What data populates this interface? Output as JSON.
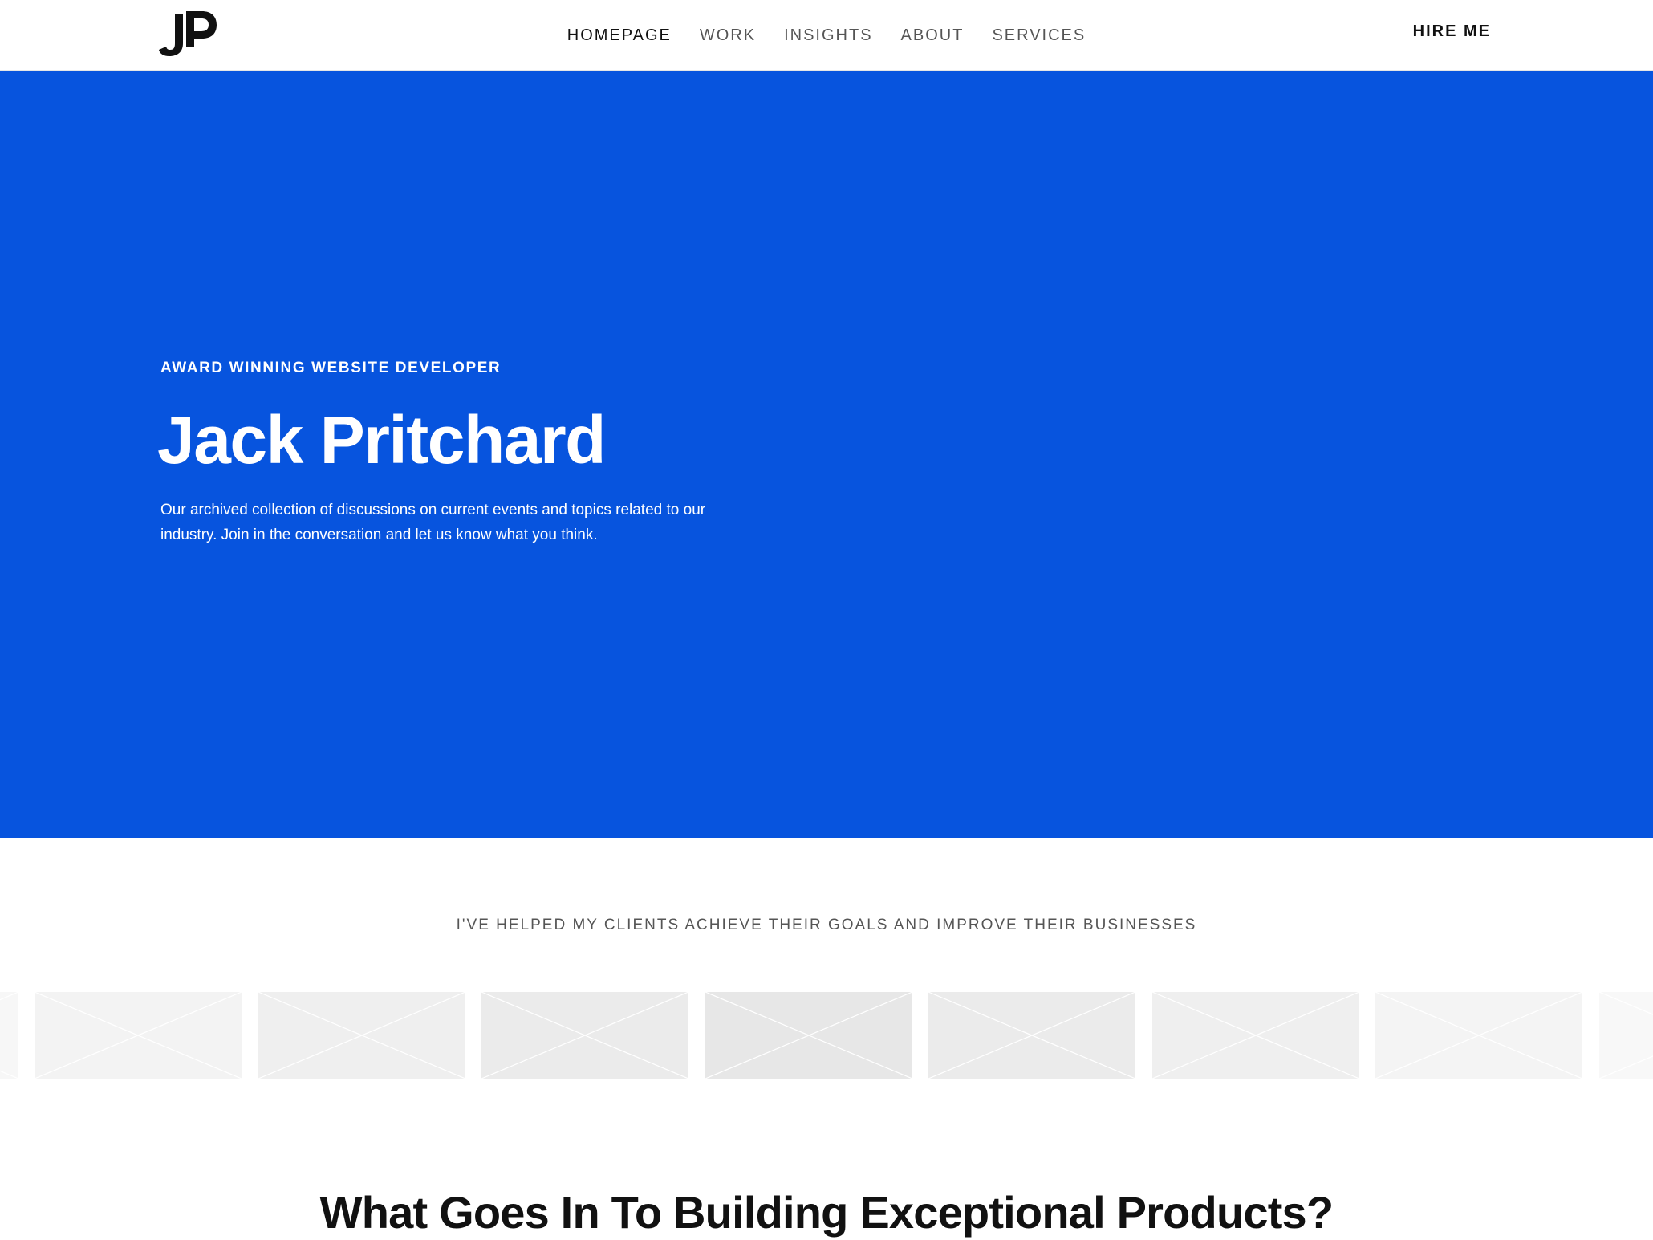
{
  "header": {
    "logo_text": "JP",
    "nav": [
      {
        "label": "HOMEPAGE",
        "active": true
      },
      {
        "label": "WORK",
        "active": false
      },
      {
        "label": "INSIGHTS",
        "active": false
      },
      {
        "label": "ABOUT",
        "active": false
      },
      {
        "label": "SERVICES",
        "active": false
      }
    ],
    "hire_label": "HIRE ME"
  },
  "hero": {
    "eyebrow": "AWARD WINNING WEBSITE DEVELOPER",
    "title": "Jack Pritchard",
    "description": "Our archived collection of discussions on current events and topics related to our industry. Join in the conversation and let us know what you think.",
    "background_color": "#0754de"
  },
  "clients": {
    "heading": "I'VE HELPED MY CLIENTS ACHIEVE THEIR GOALS AND IMPROVE THEIR BUSINESSES",
    "logos": [
      {
        "name": "client-logo-placeholder",
        "shade": "#f7f7f7"
      },
      {
        "name": "client-logo-placeholder",
        "shade": "#f3f3f3"
      },
      {
        "name": "client-logo-placeholder",
        "shade": "#efefef"
      },
      {
        "name": "client-logo-placeholder",
        "shade": "#ebebeb"
      },
      {
        "name": "client-logo-placeholder",
        "shade": "#e7e7e7"
      },
      {
        "name": "client-logo-placeholder",
        "shade": "#ebebeb"
      },
      {
        "name": "client-logo-placeholder",
        "shade": "#efefef"
      },
      {
        "name": "client-logo-placeholder",
        "shade": "#f4f4f4"
      },
      {
        "name": "client-logo-placeholder",
        "shade": "#f8f8f8"
      }
    ]
  },
  "section": {
    "title": "What Goes In To Building Exceptional Products?"
  }
}
